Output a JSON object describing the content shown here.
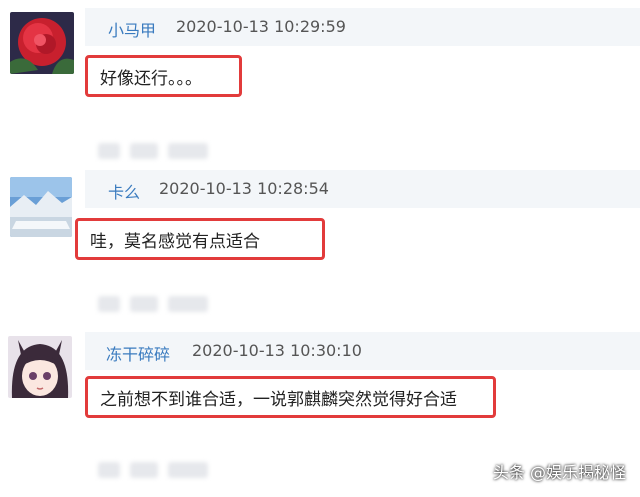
{
  "comments": [
    {
      "username": "小马甲",
      "timestamp": "2020-10-13 10:29:59",
      "content": "好像还行。。。",
      "avatar_icon": "red-rose-avatar-icon"
    },
    {
      "username": "卡么",
      "timestamp": "2020-10-13 10:28:54",
      "content": "哇，莫名感觉有点适合",
      "avatar_icon": "glacier-landscape-avatar-icon"
    },
    {
      "username": "冻干碎碎",
      "timestamp": "2020-10-13 10:30:10",
      "content": "之前想不到谁合适，一说郭麒麟突然觉得好合适",
      "avatar_icon": "anime-girl-avatar-icon"
    }
  ],
  "watermark": "头条 @娱乐揭秘怪",
  "colors": {
    "username": "#3a7bbf",
    "highlight_border": "#e23b3b",
    "header_background": "#f3f6f9"
  }
}
